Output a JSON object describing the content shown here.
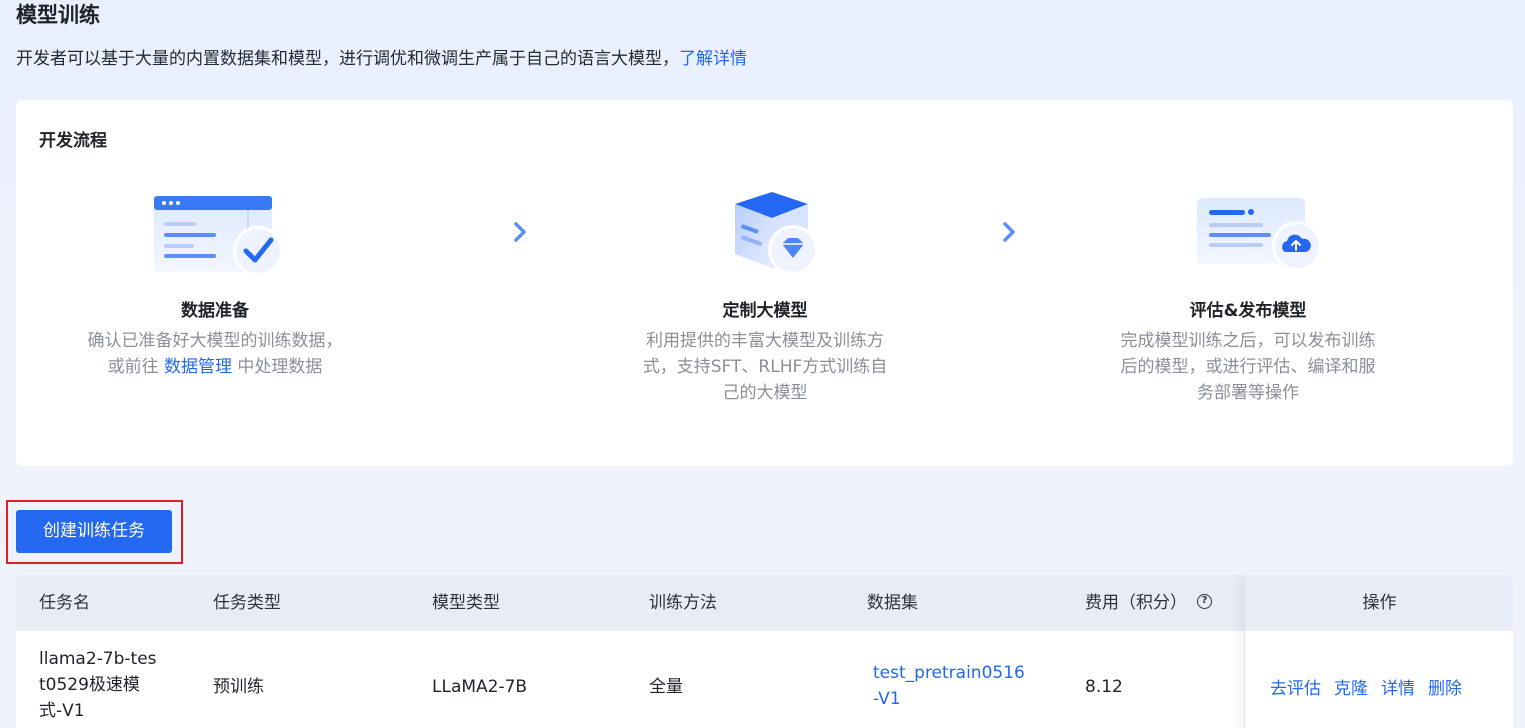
{
  "page": {
    "title": "模型训练",
    "description": "开发者可以基于大量的内置数据集和模型，进行调优和微调生产属于自己的语言大模型，",
    "learn_more": "了解详情"
  },
  "flow": {
    "title": "开发流程",
    "steps": [
      {
        "name": "数据准备",
        "desc_line1": "确认已准备好大模型的训练数据，",
        "desc_prefix": "或前往 ",
        "desc_link": "数据管理",
        "desc_suffix": " 中处理数据"
      },
      {
        "name": "定制大模型",
        "desc_line1": "利用提供的丰富大模型及训练方",
        "desc_line2": "式，支持SFT、RLHF方式训练自",
        "desc_line3": "己的大模型"
      },
      {
        "name": "评估&发布模型",
        "desc_line1": "完成模型训练之后，可以发布训练",
        "desc_line2": "后的模型，或进行评估、编译和服",
        "desc_line3": "务部署等操作"
      }
    ]
  },
  "create_button": "创建训练任务",
  "table": {
    "columns": [
      "任务名",
      "任务类型",
      "模型类型",
      "训练方法",
      "数据集",
      "费用（积分）",
      "操作"
    ],
    "help_icon": "?",
    "rows": [
      {
        "name_line1": "llama2-7b-tes",
        "name_line2": "t0529极速模",
        "name_line3": "式-V1",
        "task_type": "预训练",
        "model_type": "LLaMA2-7B",
        "method": "全量",
        "dataset_line1": "test_pretrain0516",
        "dataset_line2": "-V1",
        "cost": "8.12",
        "actions": [
          "去评估",
          "克隆",
          "详情",
          "删除"
        ]
      }
    ]
  },
  "colors": {
    "primary": "#2468f2",
    "highlight_box": "#e02020",
    "table_header_bg": "#e7ecf6"
  }
}
